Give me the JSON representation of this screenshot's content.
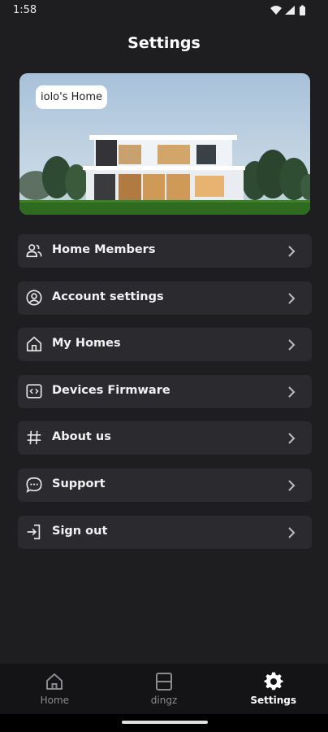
{
  "status_bar": {
    "time": "1:58",
    "icons": [
      "wifi-icon",
      "signal-icon",
      "battery-icon"
    ]
  },
  "header": {
    "title": "Settings"
  },
  "home_card": {
    "home_name": "iolo's Home"
  },
  "menu": {
    "items": [
      {
        "label": "Home Members",
        "icon": "people-icon"
      },
      {
        "label": "Account settings",
        "icon": "account-icon"
      },
      {
        "label": "My Homes",
        "icon": "house-icon"
      },
      {
        "label": "Devices Firmware",
        "icon": "code-icon"
      },
      {
        "label": "About us",
        "icon": "hash-icon"
      },
      {
        "label": "Support",
        "icon": "chat-icon"
      },
      {
        "label": "Sign out",
        "icon": "sign-out-icon"
      }
    ]
  },
  "bottom_nav": {
    "items": [
      {
        "label": "Home",
        "icon": "home-icon",
        "active": false
      },
      {
        "label": "dingz",
        "icon": "dingz-icon",
        "active": false
      },
      {
        "label": "Settings",
        "icon": "gear-icon",
        "active": true
      }
    ]
  },
  "colors": {
    "background": "#1e1e21",
    "card": "#2b2b2f",
    "nav_bar": "#141416",
    "active_text": "#ffffff",
    "inactive_text": "#8b8b8f"
  }
}
